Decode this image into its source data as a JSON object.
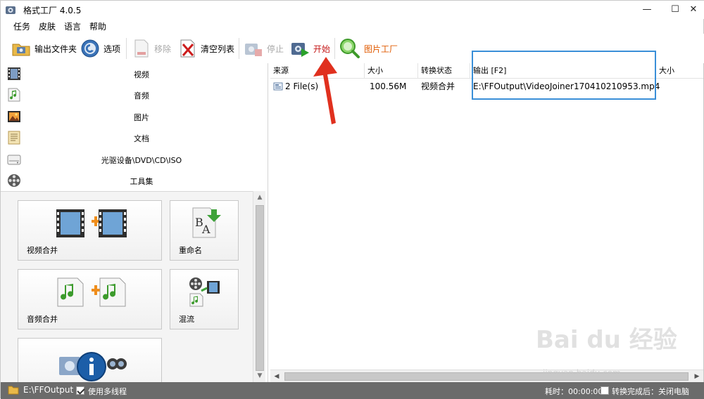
{
  "window": {
    "title": "格式工厂 4.0.5"
  },
  "menu": [
    "任务",
    "皮肤",
    "语言",
    "帮助"
  ],
  "toolbar": {
    "output_folder": "输出文件夹",
    "options": "选项",
    "remove": "移除",
    "clear_list": "清空列表",
    "stop": "停止",
    "start": "开始",
    "picture_factory": "图片工厂"
  },
  "categories": [
    "视频",
    "音频",
    "图片",
    "文档",
    "光驱设备\\DVD\\CD\\ISO",
    "工具集"
  ],
  "tools": [
    "视频合并",
    "重命名",
    "音频合并",
    "混流"
  ],
  "list": {
    "columns": [
      "来源",
      "大小",
      "转换状态",
      "输出 [F2]",
      "大小"
    ],
    "rows": [
      {
        "source": "2 File(s)",
        "size": "100.56M",
        "status": "视频合并",
        "output": "E:\\FFOutput\\VideoJoiner170410210953.mp4"
      }
    ]
  },
  "statusbar": {
    "folder": "E:\\FFOutput",
    "multithread": "使用多线程",
    "elapsed": "耗时：00:00:00",
    "after_convert": "转换完成后：关闭电脑"
  },
  "watermark": {
    "main": "Bai du 经验",
    "sub": "jingyan.baidu.com"
  },
  "colors": {
    "highlight": "#3a8fd8",
    "arrow": "#e0301e",
    "statusbar": "#6b6b6b"
  }
}
